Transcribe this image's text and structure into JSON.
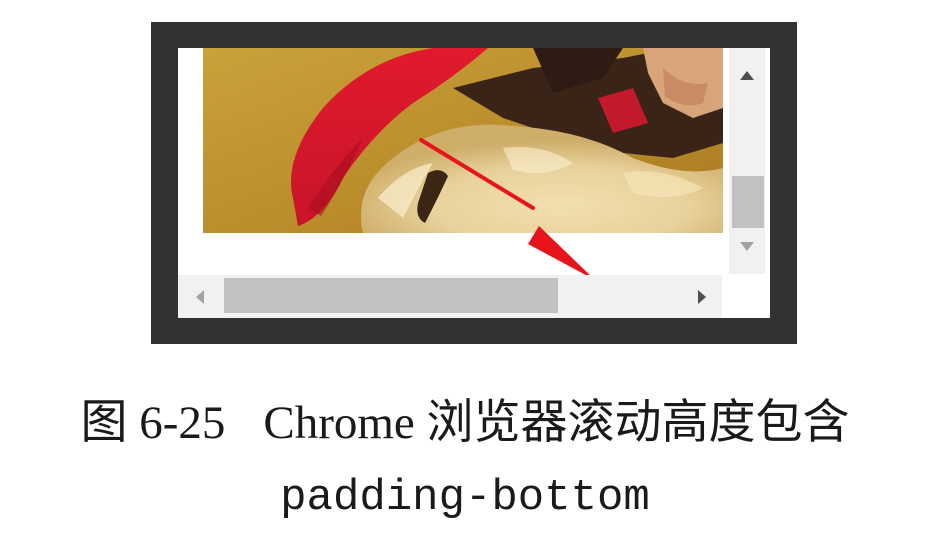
{
  "figure": {
    "number": "图 6-25",
    "caption_text": "Chrome 浏览器滚动高度包含",
    "caption_code": "padding-bottom"
  },
  "browser_window": {
    "image_content": "photo-icon",
    "vertical_scrollbar": {
      "up_icon": "triangle-up-icon",
      "down_icon": "triangle-down-icon"
    },
    "horizontal_scrollbar": {
      "left_icon": "triangle-left-icon",
      "right_icon": "triangle-right-icon"
    },
    "annotation": "arrow-icon"
  },
  "colors": {
    "frame": "#323232",
    "scrollbar_track": "#f1f1f1",
    "scrollbar_thumb": "#c1c1c1",
    "annotation_arrow": "#e8141c"
  }
}
